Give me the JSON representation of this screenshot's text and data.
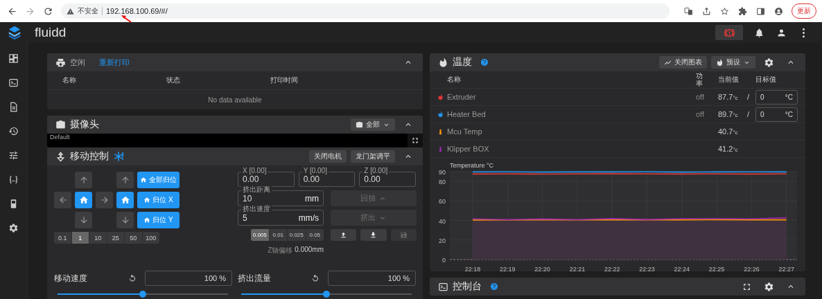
{
  "browser": {
    "security_label": "不安全",
    "url": "192.168.100.69/#/",
    "update_button": "更新"
  },
  "app_bar": {
    "title": "fluidd"
  },
  "job_card": {
    "status": "空闲",
    "reprint_button": "重新打印",
    "columns": [
      "名称",
      "状态",
      "打印时间"
    ],
    "empty_text": "No data available"
  },
  "camera_card": {
    "title": "摄像头",
    "camera_menu": "全部",
    "stream_label": "Default"
  },
  "motion_card": {
    "title": "移动控制",
    "buttons": [
      "关闭电机",
      "龙门架调平"
    ],
    "home_buttons": [
      "全部归位",
      "归位 X",
      "归位 Y"
    ],
    "steps": [
      {
        "label": "0.1",
        "selected": false
      },
      {
        "label": "1",
        "selected": true
      },
      {
        "label": "10",
        "selected": false
      },
      {
        "label": "25",
        "selected": false
      },
      {
        "label": "50",
        "selected": false
      },
      {
        "label": "100",
        "selected": false
      }
    ],
    "positions": [
      {
        "label": "X [0.00]",
        "value": "0.00"
      },
      {
        "label": "Y [0.00]",
        "value": "0.00"
      },
      {
        "label": "Z [0.00]",
        "value": "0.00"
      }
    ],
    "extrude_fields": [
      {
        "label": "挤出距离",
        "value": "10",
        "unit": "mm"
      },
      {
        "label": "挤出速度",
        "value": "5",
        "unit": "mm/s"
      }
    ],
    "extrude_buttons": [
      {
        "label": "回抽",
        "kind": "retract",
        "disabled": true
      },
      {
        "label": "挤出",
        "kind": "extrude",
        "disabled": true
      }
    ],
    "z_steps": [
      {
        "label": "0.005",
        "selected": true
      },
      {
        "label": "0.01",
        "selected": false
      },
      {
        "label": "0.025",
        "selected": false
      },
      {
        "label": "0.05",
        "selected": false
      }
    ],
    "z_buttons": [
      {
        "kind": "up",
        "disabled": false
      },
      {
        "kind": "down",
        "disabled": false
      },
      {
        "kind": "save",
        "disabled": true
      }
    ],
    "z_offset": {
      "label": "Z轴偏移",
      "value": "0.000mm"
    },
    "factors": [
      {
        "label": "移动速度",
        "value": "100 %",
        "level": 0.5
      },
      {
        "label": "挤出流量",
        "value": "100 %",
        "level": 0.5
      }
    ]
  },
  "temperature_card": {
    "title": "温度",
    "chart_button": "关闭图表",
    "presets_button": "预设",
    "columns": [
      "名称",
      "功率",
      "当前值",
      "目标值"
    ],
    "rows": [
      {
        "kind": "heater",
        "name": "Extruder",
        "color": "#e53935",
        "power": "off",
        "current": "87.7",
        "current_unit": "°c",
        "separator": "/",
        "target": "0",
        "target_unit": "°C"
      },
      {
        "kind": "heater",
        "name": "Heater Bed",
        "color": "#2196f3",
        "power": "off",
        "current": "89.7",
        "current_unit": "°c",
        "separator": "/",
        "target": "0",
        "target_unit": "°C"
      },
      {
        "kind": "sensor",
        "name": "Mcu Temp",
        "color": "#ff9800",
        "current": "40.7",
        "current_unit": "°c"
      },
      {
        "kind": "sensor",
        "name": "Klipper BOX",
        "color": "#9c27b0",
        "current": "41.2",
        "current_unit": "°c"
      }
    ],
    "chart_data": {
      "type": "line",
      "title": "Temperature °C",
      "categories": [
        "22:18",
        "22:19",
        "22:20",
        "22:21",
        "22:22",
        "22:23",
        "22:24",
        "22:25",
        "22:26",
        "22:27"
      ],
      "ylim": [
        0,
        90
      ],
      "yticks": [
        0,
        20,
        40,
        60,
        80,
        90
      ],
      "grid": true,
      "series": [
        {
          "color": "#2196f3",
          "values": [
            89.7,
            89.8,
            89.6,
            89.7,
            89.7,
            89.8,
            89.6,
            89.7,
            89.8,
            89.7
          ]
        },
        {
          "color": "#e53935",
          "values": [
            87.6,
            87.7,
            87.5,
            87.7,
            87.8,
            87.7,
            87.6,
            87.7,
            87.6,
            87.7
          ]
        },
        {
          "color": "#ff9800",
          "values": [
            40.4,
            40.5,
            40.6,
            40.5,
            40.6,
            40.7,
            40.7,
            40.8,
            40.7,
            40.7
          ]
        },
        {
          "color": "#9c27b0",
          "values": [
            41.6,
            40.9,
            41.5,
            40.9,
            41.9,
            41.0,
            41.8,
            42.0,
            41.6,
            42.8
          ]
        }
      ]
    }
  },
  "console_card": {
    "title": "控制台"
  }
}
